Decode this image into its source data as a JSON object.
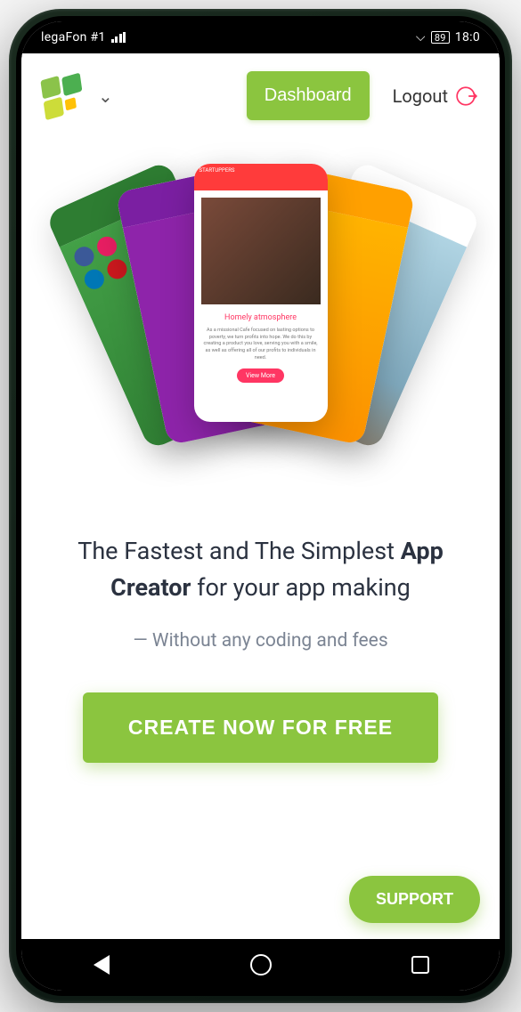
{
  "status": {
    "carrier": "legaFon #1",
    "battery": "89",
    "time": "18:0"
  },
  "header": {
    "dashboard_label": "Dashboard",
    "logout_label": "Logout"
  },
  "hero_card": {
    "brand_bar": "STARTUPPERS",
    "title": "Homely atmosphere",
    "body": "As a missional Cafe focused on lasting options to poverty, we turn profits into hope. We do this by creating a product you love, serving you with a smile, as well as offering all of our profits to individuals in need.",
    "button": "View More"
  },
  "headline": {
    "pre": "The Fastest and The Simplest ",
    "strong": "App Creator",
    "post": " for your app making"
  },
  "subhead": "— Without any coding and fees",
  "cta_label": "CREATE NOW FOR FREE",
  "support_label": "SUPPORT",
  "colors": {
    "accent": "#8bc53f"
  }
}
